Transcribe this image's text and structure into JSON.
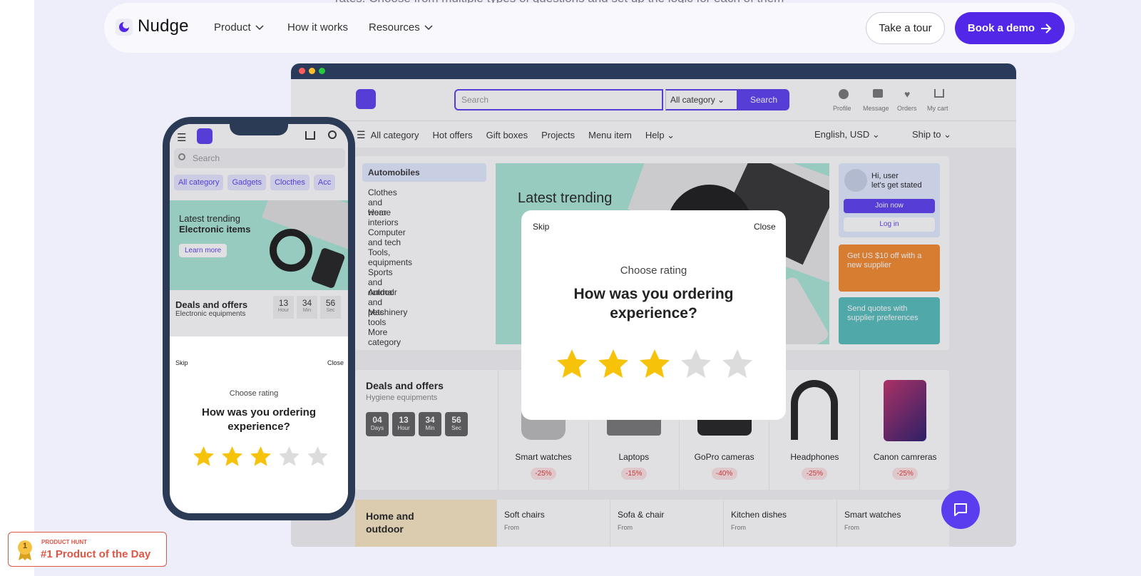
{
  "background_text": "rates. Choose from multiple types of questions and set up the logic for each of them",
  "nav": {
    "brand": "Nudge",
    "items": [
      "Product",
      "How it works",
      "Resources"
    ],
    "tour_label": "Take a tour",
    "demo_label": "Book a demo"
  },
  "desktop": {
    "search_placeholder": "Search",
    "category_select": "All category",
    "search_button": "Search",
    "top_icons": [
      "Profile",
      "Message",
      "Orders",
      "My cart"
    ],
    "menu": [
      "All category",
      "Hot offers",
      "Gift boxes",
      "Projects",
      "Menu item",
      "Help"
    ],
    "language": "English, USD",
    "ship_to": "Ship to",
    "categories": [
      "Automobiles",
      "Clothes and wear",
      "Home interiors",
      "Computer and tech",
      "Tools, equipments",
      "Sports and outdoor",
      "Animal and pets",
      "Machinery tools",
      "More category"
    ],
    "banner_title": "Latest trending",
    "user_greeting": "Hi, user",
    "user_subtitle": "let's get stated",
    "join_button": "Join now",
    "login_button": "Log in",
    "promo_orange": "Get US $10 off with a new supplier",
    "promo_teal": "Send quotes with supplier preferences",
    "deals_title": "Deals and offers",
    "deals_subtitle": "Hygiene equipments",
    "timer": [
      {
        "value": "04",
        "unit": "Days"
      },
      {
        "value": "13",
        "unit": "Hour"
      },
      {
        "value": "34",
        "unit": "Min"
      },
      {
        "value": "56",
        "unit": "Sec"
      }
    ],
    "products": [
      {
        "name": "Smart watches",
        "discount": "-25%"
      },
      {
        "name": "Laptops",
        "discount": "-15%"
      },
      {
        "name": "GoPro cameras",
        "discount": "-40%"
      },
      {
        "name": "Headphones",
        "discount": "-25%"
      },
      {
        "name": "Canon camreras",
        "discount": "-25%"
      }
    ],
    "home_outdoor": "Home and outdoor",
    "home_items": [
      "Soft chairs",
      "Sofa & chair",
      "Kitchen dishes",
      "Smart watches"
    ],
    "from_label": "From"
  },
  "modal": {
    "skip": "Skip",
    "close": "Close",
    "subtitle": "Choose rating",
    "question": "How was you ordering experience?",
    "rating": 3,
    "max_rating": 5
  },
  "phone": {
    "search_placeholder": "Search",
    "chips": [
      "All category",
      "Gadgets",
      "Clocthes",
      "Acc"
    ],
    "banner_line1": "Latest trending",
    "banner_line2": "Electronic items",
    "learn_more": "Learn more",
    "deals_title": "Deals and offers",
    "deals_subtitle": "Electronic equipments",
    "timer": [
      {
        "value": "13",
        "unit": "Hour"
      },
      {
        "value": "34",
        "unit": "Min"
      },
      {
        "value": "56",
        "unit": "Sec"
      }
    ],
    "modal_skip": "Skip",
    "modal_close": "Close",
    "modal_subtitle": "Choose rating",
    "modal_question": "How was you ordering experience?",
    "rating": 3
  },
  "product_hunt": {
    "kicker": "PRODUCT HUNT",
    "title": "#1 Product of the Day",
    "rank": "1"
  },
  "colors": {
    "brand": "#5327e8",
    "star_active": "#f7c20a",
    "star_inactive": "#dcdcdc",
    "product_hunt": "#e05545"
  }
}
